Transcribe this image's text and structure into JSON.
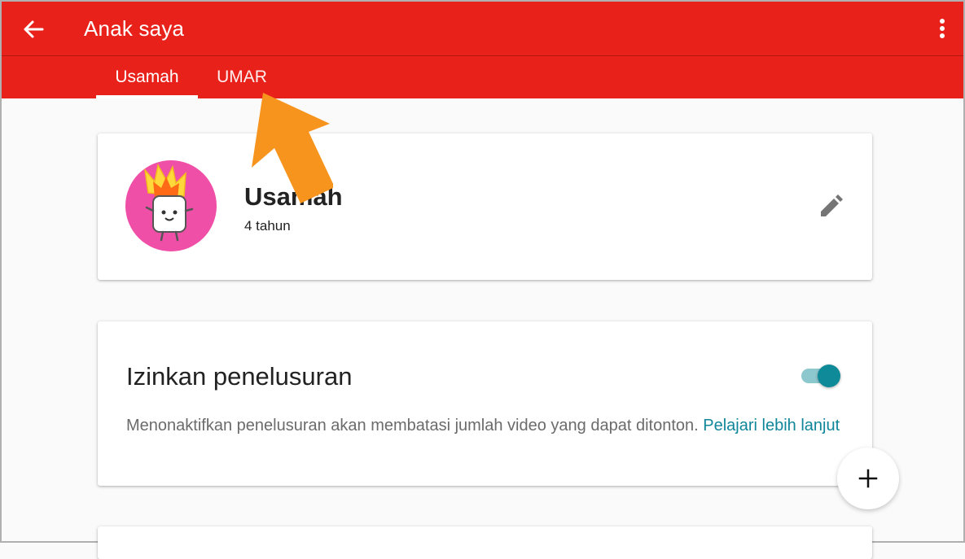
{
  "appbar": {
    "title": "Anak saya",
    "back_icon": "arrow-back-icon",
    "menu_icon": "more-vert-icon",
    "color": "#e8221a"
  },
  "tabs": [
    {
      "label": "Usamah",
      "selected": true
    },
    {
      "label": "UMAR",
      "selected": false
    }
  ],
  "profile": {
    "name": "Usamah",
    "age": "4 tahun",
    "avatar_icon": "flaming-marshmallow-avatar-icon",
    "avatar_color": "#f04fa8",
    "edit_icon": "pencil-icon"
  },
  "search_setting": {
    "title": "Izinkan penelusuran",
    "description": "Menonaktifkan penelusuran akan membatasi jumlah video yang dapat ditonton.",
    "link_label": "Pelajari lebih lanjut",
    "enabled": true,
    "accent": "#0f8a98"
  },
  "fab": {
    "icon": "plus-icon"
  },
  "annotation": {
    "icon": "orange-pointer-arrow-icon",
    "color": "#f7941d"
  }
}
